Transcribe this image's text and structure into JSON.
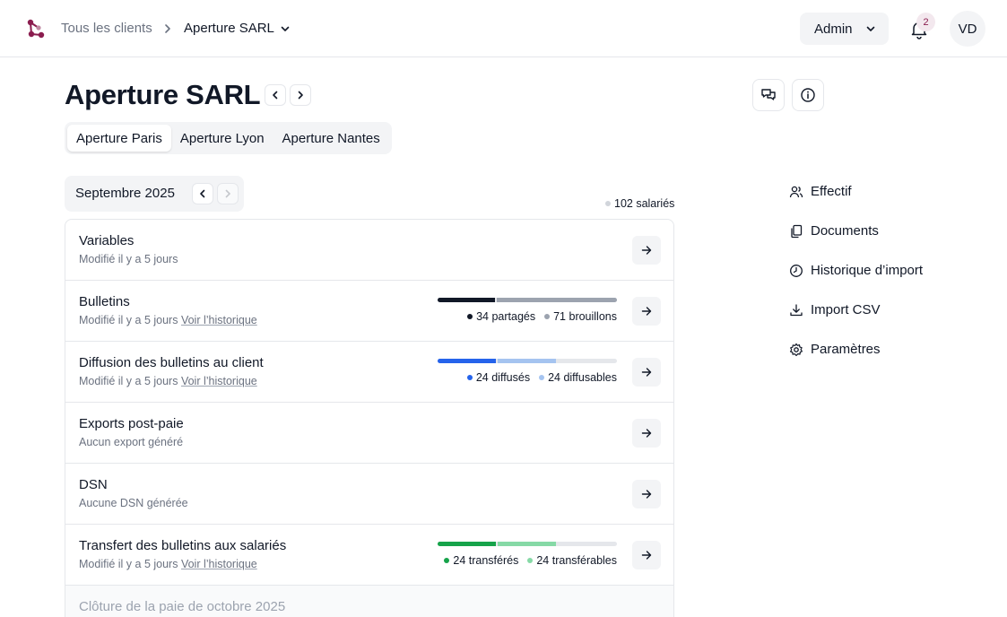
{
  "header": {
    "breadcrumb_root": "Tous les clients",
    "breadcrumb_current": "Aperture SARL",
    "role_label": "Admin",
    "notification_count": "2",
    "avatar_initials": "VD"
  },
  "page": {
    "title": "Aperture SARL"
  },
  "sites": {
    "tabs": [
      {
        "label": "Aperture Paris",
        "active": true
      },
      {
        "label": "Aperture Lyon",
        "active": false
      },
      {
        "label": "Aperture Nantes",
        "active": false
      }
    ]
  },
  "period": {
    "month_label": "Septembre 2025",
    "employees_count": "102 salariés"
  },
  "rows": [
    {
      "title": "Variables",
      "subtitle": "Modifié il y a 5 jours",
      "history_link": ""
    },
    {
      "title": "Bulletins",
      "subtitle": "Modifié il y a 5 jours",
      "history_link": "Voir l’historique",
      "progress": {
        "segments": [
          {
            "label": "34 partagés",
            "value": 34,
            "color": "#111827"
          },
          {
            "label": "71 brouillons",
            "value": 71,
            "color": "#9ca3af"
          }
        ],
        "total": 102
      }
    },
    {
      "title": "Diffusion des bulletins au client",
      "subtitle": "Modifié il y a 5 jours",
      "history_link": "Voir l’historique",
      "progress": {
        "segments": [
          {
            "label": "24 diffusés",
            "value": 24,
            "color": "#2563eb"
          },
          {
            "label": "24 diffusables",
            "value": 24,
            "color": "#a5c4f0"
          }
        ],
        "total": 74
      }
    },
    {
      "title": "Exports post-paie",
      "subtitle": "Aucun export généré",
      "history_link": ""
    },
    {
      "title": "DSN",
      "subtitle": "Aucune DSN générée",
      "history_link": ""
    },
    {
      "title": "Transfert des bulletins aux salariés",
      "subtitle": "Modifié il y a 5 jours",
      "history_link": "Voir l’historique",
      "progress": {
        "segments": [
          {
            "label": "24 transférés",
            "value": 24,
            "color": "#16a34a"
          },
          {
            "label": "24 transférables",
            "value": 24,
            "color": "#86d9a6"
          }
        ],
        "total": 74
      }
    },
    {
      "title": "Clôture de la paie de octobre 2025",
      "subtitle": "",
      "history_link": ""
    }
  ],
  "sidebar": {
    "items": [
      {
        "label": "Effectif",
        "icon": "users-icon"
      },
      {
        "label": "Documents",
        "icon": "documents-icon"
      },
      {
        "label": "Historique d’import",
        "icon": "history-icon"
      },
      {
        "label": "Import CSV",
        "icon": "download-icon"
      },
      {
        "label": "Paramètres",
        "icon": "settings-icon"
      }
    ]
  },
  "colors": {
    "brand": "#8b1d4f",
    "muted_bg": "#f3f4f6",
    "border": "#e5e7eb"
  }
}
